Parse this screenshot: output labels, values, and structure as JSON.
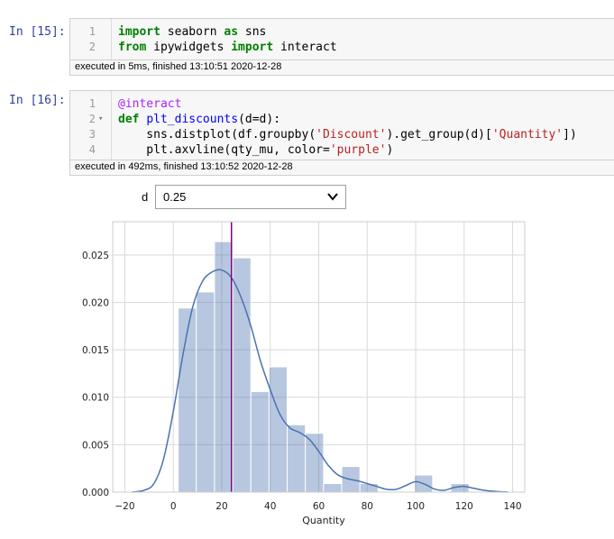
{
  "cells": [
    {
      "prompt": "In [15]:",
      "lines": [
        {
          "no": "1",
          "parts": [
            {
              "t": "import",
              "c": "kw"
            },
            {
              "t": " seaborn ",
              "c": ""
            },
            {
              "t": "as",
              "c": "kw"
            },
            {
              "t": " sns",
              "c": ""
            }
          ]
        },
        {
          "no": "2",
          "parts": [
            {
              "t": "from",
              "c": "kw"
            },
            {
              "t": " ipywidgets ",
              "c": ""
            },
            {
              "t": "import",
              "c": "kw"
            },
            {
              "t": " interact",
              "c": ""
            }
          ]
        }
      ],
      "exec": "executed in 5ms, finished 13:10:51 2020-12-28"
    },
    {
      "prompt": "In [16]:",
      "lines": [
        {
          "no": "1",
          "parts": [
            {
              "t": "@interact",
              "c": "dec"
            }
          ]
        },
        {
          "no": "2",
          "fold": "▾",
          "parts": [
            {
              "t": "def",
              "c": "kw"
            },
            {
              "t": " ",
              "c": ""
            },
            {
              "t": "plt_discounts",
              "c": "fn"
            },
            {
              "t": "(d=d):",
              "c": ""
            }
          ]
        },
        {
          "no": "3",
          "parts": [
            {
              "t": "    sns.distplot(df.groupby(",
              "c": ""
            },
            {
              "t": "'Discount'",
              "c": "str"
            },
            {
              "t": ").get_group(d)[",
              "c": ""
            },
            {
              "t": "'Quantity'",
              "c": "str"
            },
            {
              "t": "])",
              "c": ""
            }
          ]
        },
        {
          "no": "4",
          "parts": [
            {
              "t": "    plt.axvline(qty_mu, color=",
              "c": ""
            },
            {
              "t": "'purple'",
              "c": "str"
            },
            {
              "t": ")",
              "c": ""
            }
          ]
        }
      ],
      "exec": "executed in 492ms, finished 13:10:52 2020-12-28"
    }
  ],
  "widget": {
    "label": "d",
    "value": "0.25"
  },
  "chart_data": {
    "type": "bar",
    "xlabel": "Quantity",
    "ylabel": "",
    "xlim": [
      -25,
      145
    ],
    "ylim": [
      0,
      0.0285
    ],
    "xticks": [
      -20,
      0,
      20,
      40,
      60,
      80,
      100,
      120,
      140
    ],
    "xtick_labels": [
      "−20",
      "0",
      "20",
      "40",
      "60",
      "80",
      "100",
      "120",
      "140"
    ],
    "yticks": [
      0,
      0.005,
      0.01,
      0.015,
      0.02,
      0.025
    ],
    "ytick_labels": [
      "0.000",
      "0.005",
      "0.010",
      "0.015",
      "0.020",
      "0.025"
    ],
    "grid": true,
    "bar_color": "#4c72b0",
    "kde_color": "#4c72b0",
    "vline_color": "#800080",
    "hist": [
      {
        "x0": 2,
        "x1": 9.5,
        "y": 0.0194
      },
      {
        "x0": 9.5,
        "x1": 17,
        "y": 0.0211
      },
      {
        "x0": 17,
        "x1": 24.5,
        "y": 0.0264
      },
      {
        "x0": 24.5,
        "x1": 32,
        "y": 0.0247
      },
      {
        "x0": 32,
        "x1": 39.5,
        "y": 0.0106
      },
      {
        "x0": 39.5,
        "x1": 47,
        "y": 0.0132
      },
      {
        "x0": 47,
        "x1": 54.5,
        "y": 0.0071
      },
      {
        "x0": 54.5,
        "x1": 62,
        "y": 0.0062
      },
      {
        "x0": 62,
        "x1": 69.5,
        "y": 0.0009
      },
      {
        "x0": 69.5,
        "x1": 77,
        "y": 0.0027
      },
      {
        "x0": 77,
        "x1": 84.5,
        "y": 0.0009
      },
      {
        "x0": 84.5,
        "x1": 92,
        "y": 0
      },
      {
        "x0": 92,
        "x1": 99.5,
        "y": 0
      },
      {
        "x0": 99.5,
        "x1": 107,
        "y": 0.0018
      },
      {
        "x0": 107,
        "x1": 114.5,
        "y": 0
      },
      {
        "x0": 114.5,
        "x1": 122,
        "y": 0.0009
      }
    ],
    "kde": [
      [
        -17,
        0
      ],
      [
        -12,
        0.0002
      ],
      [
        -8,
        0.0009
      ],
      [
        -4,
        0.0035
      ],
      [
        0,
        0.0085
      ],
      [
        4,
        0.0145
      ],
      [
        8,
        0.0195
      ],
      [
        12,
        0.0222
      ],
      [
        16,
        0.0232
      ],
      [
        20,
        0.0234
      ],
      [
        24,
        0.0226
      ],
      [
        28,
        0.0205
      ],
      [
        32,
        0.0175
      ],
      [
        36,
        0.0138
      ],
      [
        40,
        0.0108
      ],
      [
        44,
        0.0082
      ],
      [
        48,
        0.0068
      ],
      [
        52,
        0.0063
      ],
      [
        56,
        0.0056
      ],
      [
        60,
        0.0043
      ],
      [
        64,
        0.0028
      ],
      [
        68,
        0.0018
      ],
      [
        72,
        0.0014
      ],
      [
        76,
        0.0012
      ],
      [
        80,
        0.0009
      ],
      [
        84,
        0.0006
      ],
      [
        88,
        0.0003
      ],
      [
        92,
        0.0003
      ],
      [
        96,
        0.0007
      ],
      [
        100,
        0.0011
      ],
      [
        104,
        0.0008
      ],
      [
        108,
        0.0003
      ],
      [
        112,
        0.0002
      ],
      [
        116,
        0.0005
      ],
      [
        120,
        0.0006
      ],
      [
        124,
        0.0004
      ],
      [
        128,
        0.0002
      ],
      [
        132,
        0.0001
      ],
      [
        138,
        0
      ]
    ],
    "vline": 24
  }
}
